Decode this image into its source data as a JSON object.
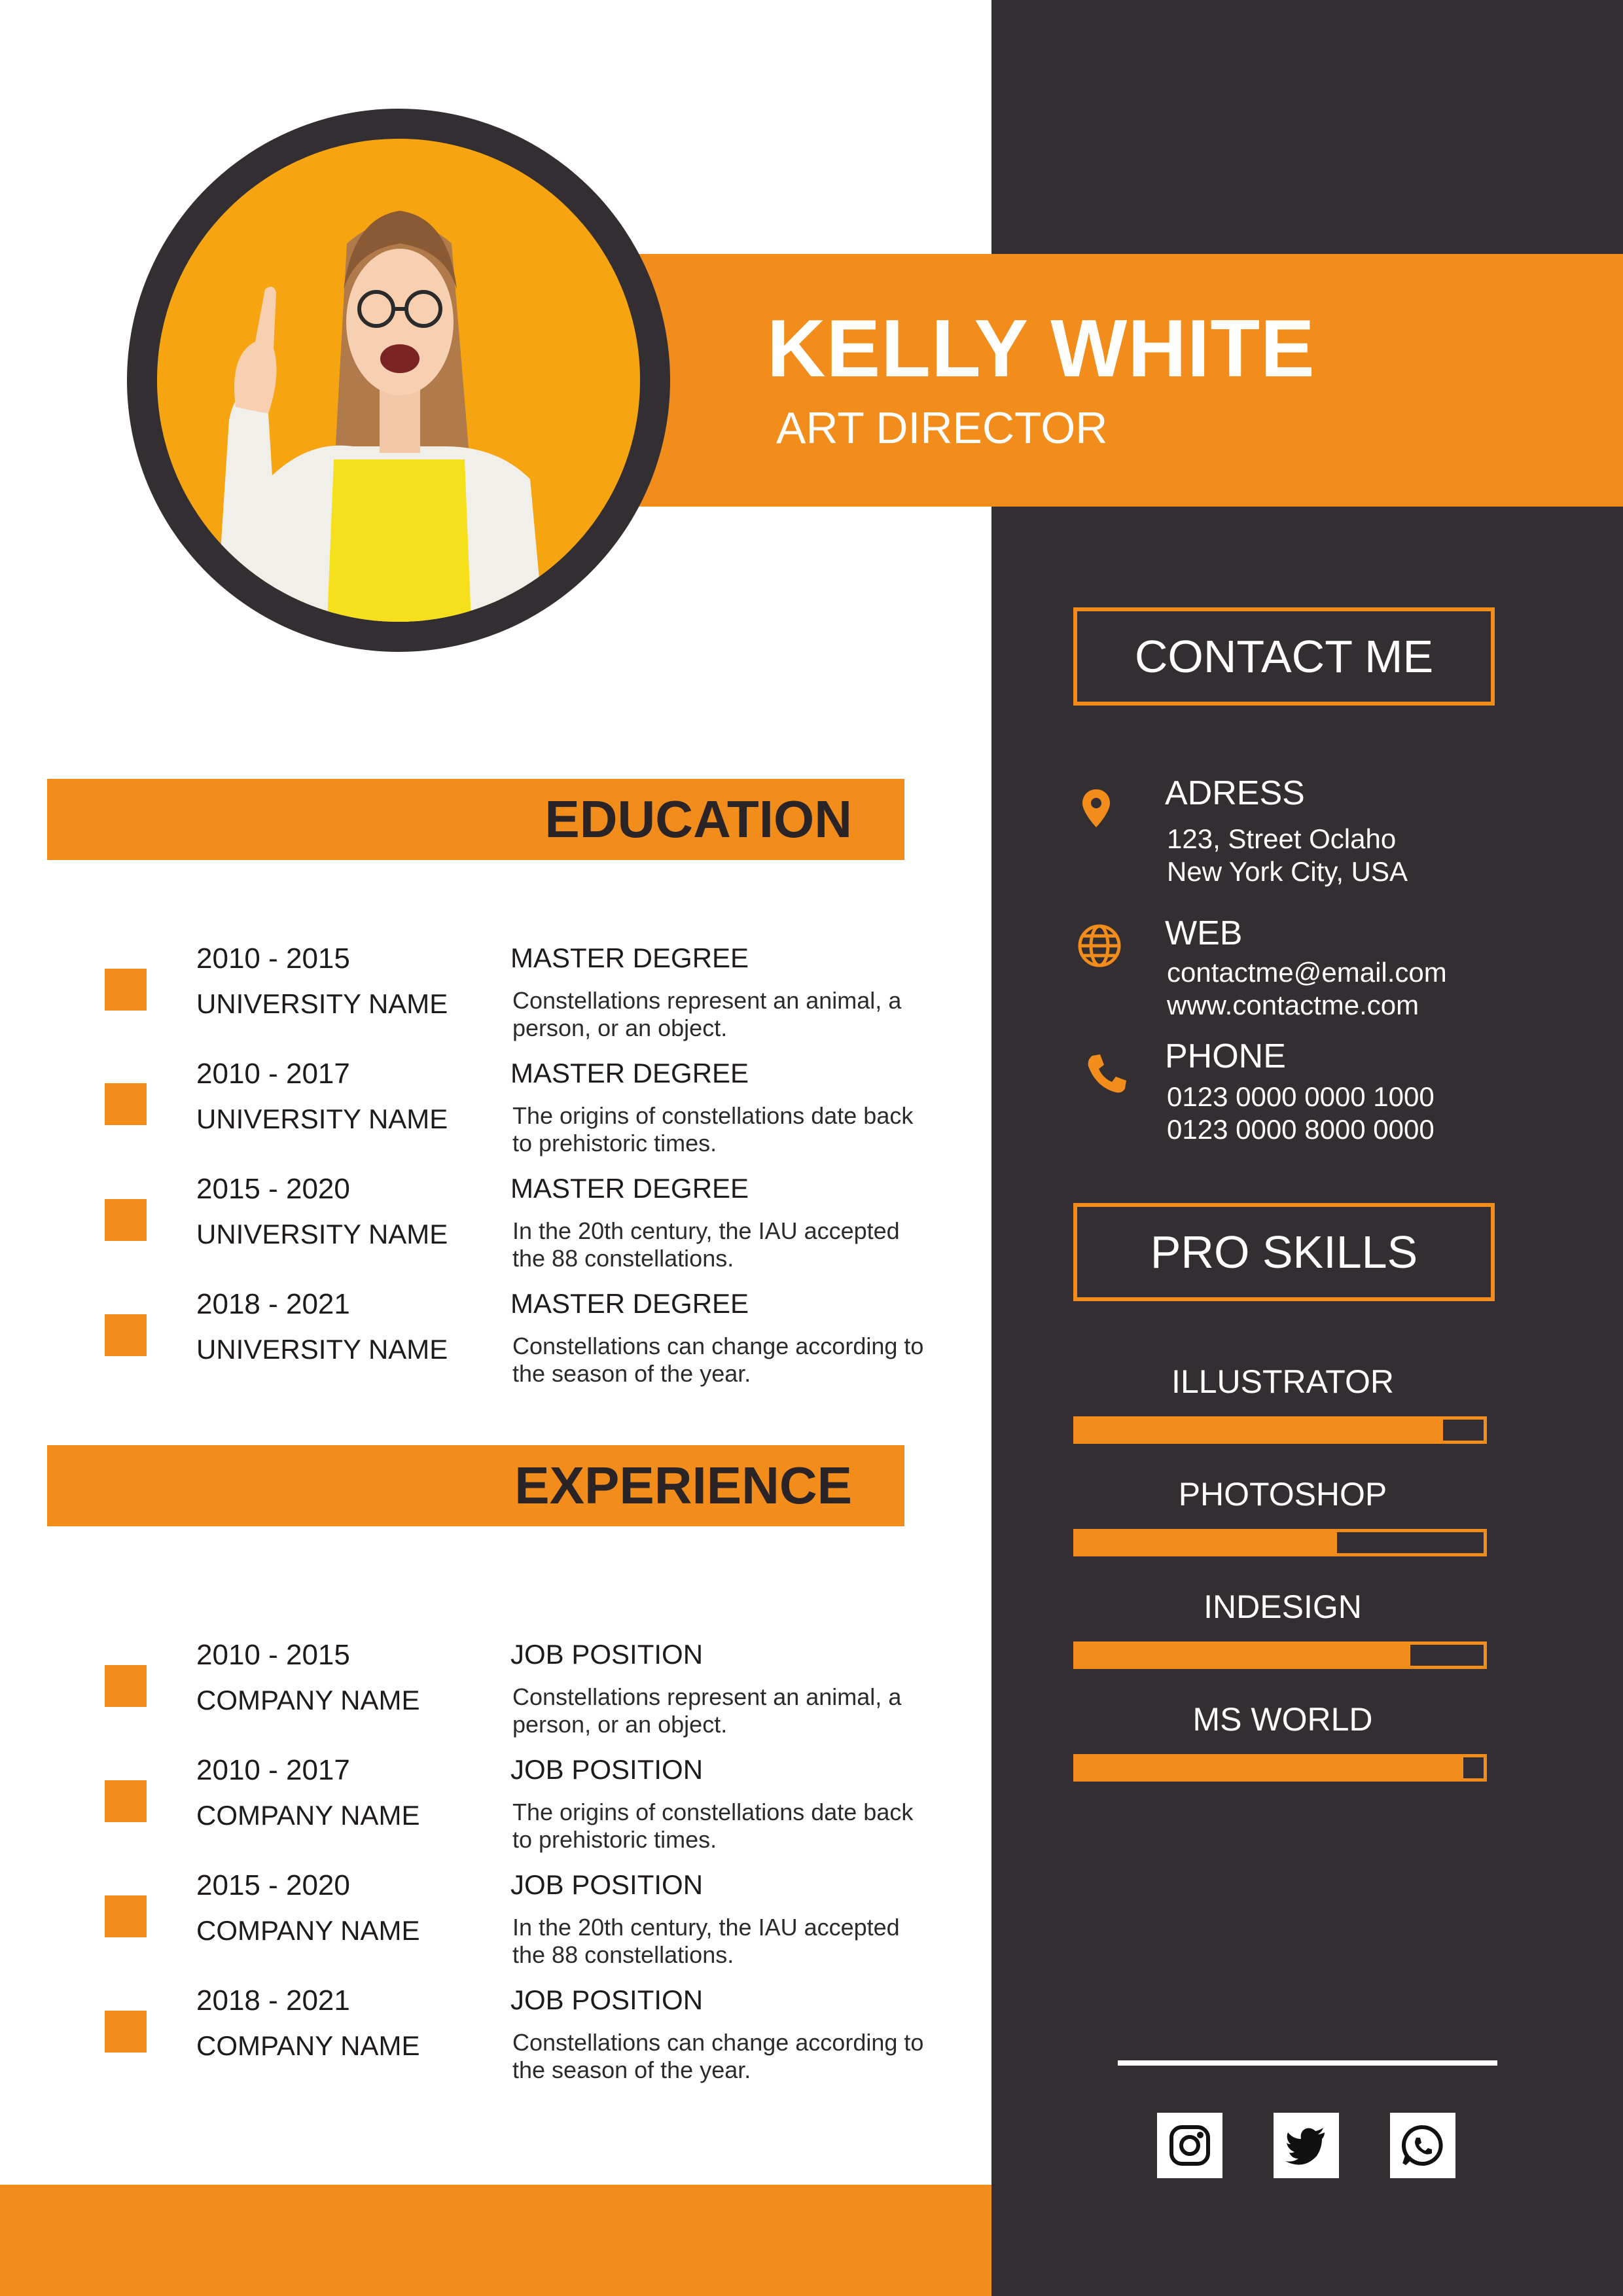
{
  "header": {
    "name": "KELLY WHITE",
    "role": "ART DIRECTOR"
  },
  "education": {
    "title": "EDUCATION",
    "items": [
      {
        "years": "2010 - 2015",
        "org": "UNIVERSITY NAME",
        "degree": "MASTER DEGREE",
        "desc": "Constellations represent an animal, a person, or an object."
      },
      {
        "years": "2010 - 2017",
        "org": "UNIVERSITY NAME",
        "degree": "MASTER DEGREE",
        "desc": "The origins of constellations date back to prehistoric times."
      },
      {
        "years": "2015 - 2020",
        "org": "UNIVERSITY NAME",
        "degree": "MASTER DEGREE",
        "desc": "In the 20th century, the IAU accepted the 88 constellations."
      },
      {
        "years": "2018 - 2021",
        "org": "UNIVERSITY NAME",
        "degree": "MASTER DEGREE",
        "desc": "Constellations can change according to the season of the year."
      }
    ]
  },
  "experience": {
    "title": "EXPERIENCE",
    "items": [
      {
        "years": "2010 - 2015",
        "org": "COMPANY NAME",
        "degree": "JOB POSITION",
        "desc": "Constellations represent an animal, a person, or an object."
      },
      {
        "years": "2010 - 2017",
        "org": "COMPANY NAME",
        "degree": "JOB POSITION",
        "desc": "The origins of constellations date back to prehistoric times."
      },
      {
        "years": "2015 - 2020",
        "org": "COMPANY NAME",
        "degree": "JOB POSITION",
        "desc": "In the 20th century, the IAU accepted the 88 constellations."
      },
      {
        "years": "2018 - 2021",
        "org": "COMPANY NAME",
        "degree": "JOB POSITION",
        "desc": "Constellations can change according to the season of the year."
      }
    ]
  },
  "contact": {
    "title": "CONTACT ME",
    "address": {
      "label": "ADRESS",
      "line1": "123, Street Oclaho",
      "line2": "New York City, USA",
      "icon": "location-pin-icon"
    },
    "web": {
      "label": "WEB",
      "line1": "contactme@email.com",
      "line2": "www.contactme.com",
      "icon": "globe-icon"
    },
    "phone": {
      "label": "PHONE",
      "line1": "0123 0000 0000 1000",
      "line2": "0123 0000 8000 0000",
      "icon": "phone-icon"
    }
  },
  "skills": {
    "title": "PRO SKILLS",
    "items": [
      {
        "name": "ILLUSTRATOR",
        "level": 0.9
      },
      {
        "name": "PHOTOSHOP",
        "level": 0.64
      },
      {
        "name": "INDESIGN",
        "level": 0.82
      },
      {
        "name": "MS WORLD",
        "level": 0.95
      }
    ]
  },
  "social": [
    "instagram-icon",
    "twitter-icon",
    "whatsapp-icon"
  ],
  "colors": {
    "accent": "#f28c1b",
    "dark": "#332e31",
    "photo_bg": "#f6a511"
  }
}
